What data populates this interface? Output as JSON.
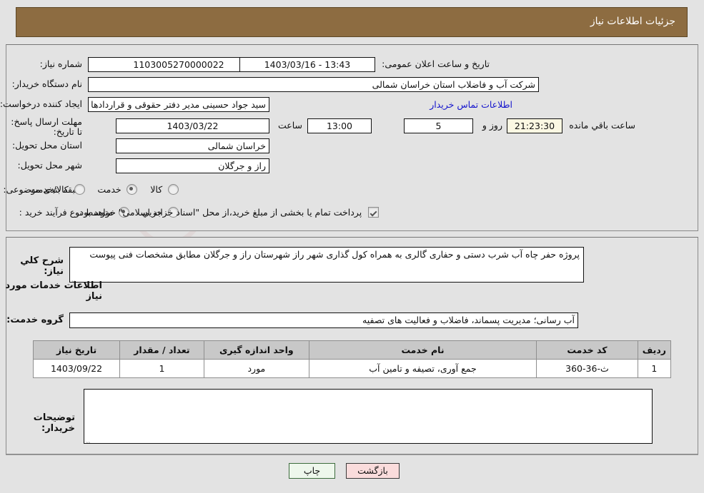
{
  "header": {
    "title": "جزئیات اطلاعات نیاز"
  },
  "form": {
    "need_number_label": "شماره نیاز:",
    "need_number_value": "1103005270000022",
    "announce_label": "تاریخ و ساعت اعلان عمومی:",
    "announce_value": "1403/03/16 - 13:43",
    "buyer_org_label": "نام دستگاه خریدار:",
    "buyer_org_value": "شرکت آب و فاضلاب استان خراسان شمالی",
    "creator_label": "ایجاد کننده درخواست:",
    "creator_value": "سید جواد حسینی مدیر دفتر حقوقی و قراردادها  شرکت آب و فاضلاب استان خرا",
    "buyer_contact_link": "اطلاعات تماس خریدار",
    "deadline_label": "مهلت ارسال پاسخ: تا تاریخ:",
    "deadline_date": "1403/03/22",
    "hour_label": "ساعت",
    "deadline_time": "13:00",
    "days_remaining": "5",
    "days_label": "روز و",
    "time_remaining": "21:23:30",
    "remaining_suffix": "ساعت باقي مانده",
    "province_label": "استان محل تحویل:",
    "province_value": "خراسان شمالی",
    "city_label": "شهر محل تحویل:",
    "city_value": "راز و جرگلان",
    "category_label": "طبقه بندی موضوعی:",
    "category_options": [
      "کالا",
      "خدمت",
      "کالا/خدمت"
    ],
    "category_selected": "خدمت",
    "process_label": "نوع فرآیند خرید :",
    "process_options": [
      "جزیي",
      "متوسط"
    ],
    "process_selected": "متوسط",
    "treasury_checkbox_label": "پرداخت تمام یا بخشی از مبلغ خرید،از محل \"اسناد خزانه اسلامی\" خواهد بود.",
    "treasury_checked": true
  },
  "details": {
    "summary_label": "شرح کلي نیاز:",
    "summary_value": "پروژه حفر چاه آب شرب دستی و حفاری گالری به همراه کول گذاری شهر راز شهرستان راز و جرگلان مطابق مشخصات فنی پیوست",
    "services_section_title": "اطلاعات خدمات مورد نیاز",
    "service_group_label": "گروه خدمت:",
    "service_group_value": "آب رسانی؛ مدیریت پسماند، فاضلاب و فعالیت های تصفیه"
  },
  "table": {
    "columns": [
      "ردیف",
      "کد خدمت",
      "نام خدمت",
      "واحد اندازه گیری",
      "تعداد / مقدار",
      "تاریخ نیاز"
    ],
    "rows": [
      {
        "row_no": "1",
        "service_code": "ث-36-360",
        "service_name": "جمع آوری، تصیفه و تامین آب",
        "unit": "مورد",
        "quantity": "1",
        "need_date": "1403/09/22"
      }
    ]
  },
  "buyer_notes": {
    "label": "توضیحات خریدار:",
    "value": ""
  },
  "footer": {
    "print_label": "چاپ",
    "back_label": "بازگشت"
  },
  "watermark": {
    "text": "AnaTender.net"
  },
  "colors": {
    "header_bar": "#8d6c41",
    "link": "#1414cd",
    "print_button": "#eef7ec",
    "back_button": "#fadcdc",
    "table_header": "#c8c8c8",
    "page_background": "#e3e3e3",
    "countdown_field": "#fbf8e3"
  }
}
